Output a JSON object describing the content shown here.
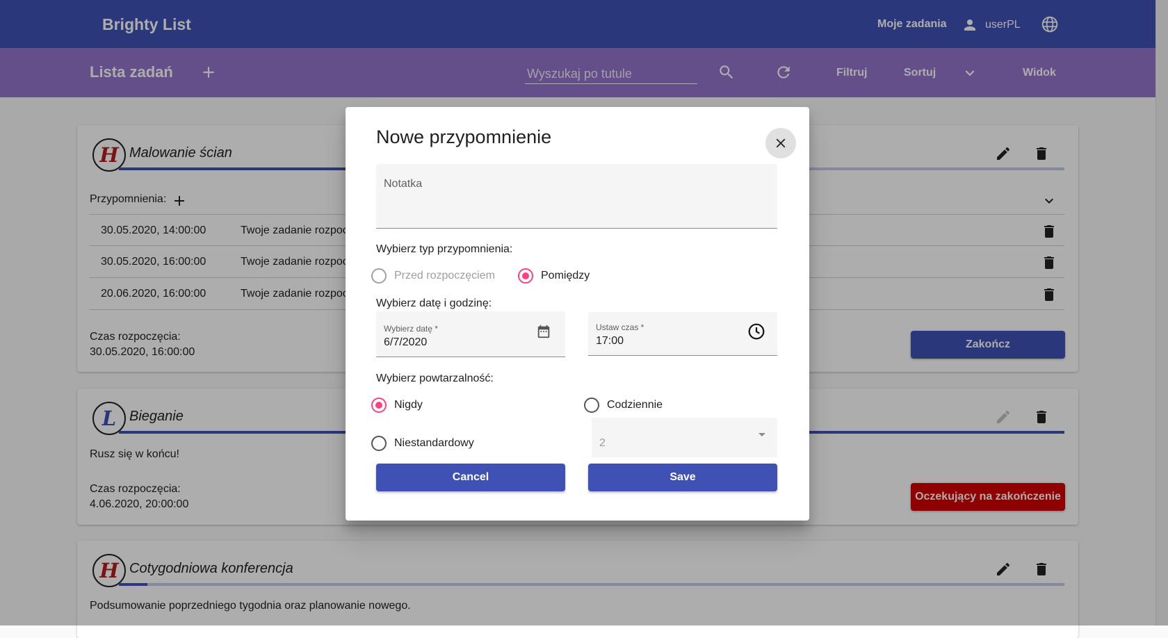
{
  "app": {
    "brand": "Brighty List",
    "nav_my_tasks": "Moje zadania",
    "user": "userPL"
  },
  "subbar": {
    "title": "Lista zadań",
    "search_placeholder": "Wyszukaj po tutule",
    "filter": "Filtruj",
    "sort": "Sortuj",
    "view": "Widok"
  },
  "tasks": [
    {
      "priority": "H",
      "priority_color": "#b71c1c",
      "title": "Malowanie ścian",
      "progress": 0.25,
      "reminders_label": "Przypomnienia:",
      "reminders": [
        {
          "date": "30.05.2020, 14:00:00",
          "text": "Twoje zadanie rozpoc"
        },
        {
          "date": "30.05.2020, 16:00:00",
          "text": "Twoje zadanie rozpoc"
        },
        {
          "date": "20.06.2020, 16:00:00",
          "text": "Twoje zadanie rozpoc"
        }
      ],
      "start_label": "Czas rozpoczęcia:",
      "start_value": "30.05.2020, 16:00:00",
      "action": "Zakończ"
    },
    {
      "priority": "L",
      "priority_color": "#3f51b5",
      "title": "Bieganie",
      "progress": 1.0,
      "description": "Rusz się w końcu!",
      "start_label": "Czas rozpoczęcia:",
      "start_value": "4.06.2020, 20:00:00",
      "action": "Oczekujący na zakończenie"
    },
    {
      "priority": "H",
      "priority_color": "#b71c1c",
      "title": "Cotygodniowa konferencja",
      "progress": 0.03,
      "description": "Podsumowanie poprzedniego tygodnia oraz planowanie nowego."
    }
  ],
  "dialog": {
    "title": "Nowe przypomnienie",
    "note_label": "Notatka",
    "note_value": "",
    "type_label": "Wybierz typ przypomnienia:",
    "type_options": [
      "Przed rozpoczęciem",
      "Pomiędzy"
    ],
    "type_selected": "Pomiędzy",
    "datetime_label": "Wybierz datę i godzinę:",
    "date_label": "Wybierz datę *",
    "date_value": "6/7/2020",
    "time_label": "Ustaw czas *",
    "time_value": "17:00",
    "repeat_label": "Wybierz powtarzalność:",
    "repeat_options": [
      "Nigdy",
      "Codziennie",
      "Niestandardowy"
    ],
    "repeat_selected": "Nigdy",
    "custom_value": "2",
    "cancel": "Cancel",
    "save": "Save"
  },
  "colors": {
    "primary": "#3f51b5",
    "accent": "#ff4081",
    "secondary_bar": "#9575cd",
    "danger": "#d50000"
  }
}
